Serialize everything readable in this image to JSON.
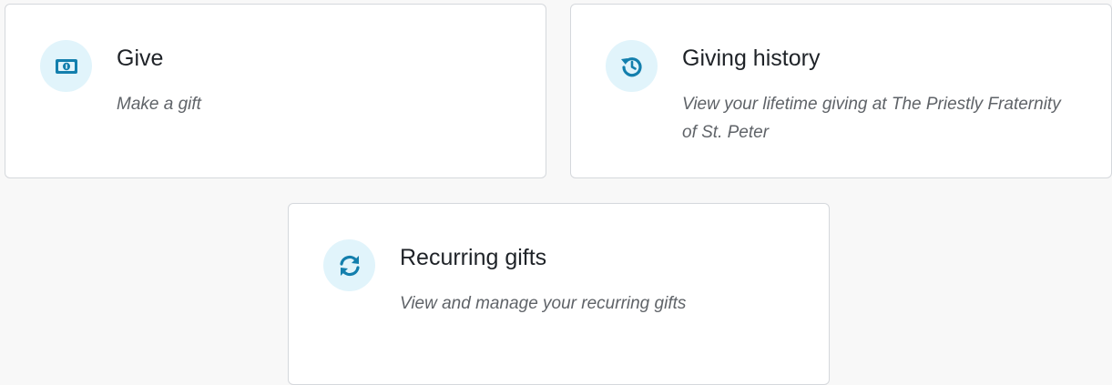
{
  "cards": {
    "give": {
      "title": "Give",
      "description": "Make a gift",
      "icon": "money-bill-icon"
    },
    "history": {
      "title": "Giving history",
      "description": "View your lifetime giving at The Priestly Fraternity of St. Peter",
      "icon": "history-icon"
    },
    "recurring": {
      "title": "Recurring gifts",
      "description": "View and manage your recurring gifts",
      "icon": "sync-icon"
    }
  },
  "colors": {
    "icon_color": "#137fad",
    "icon_background": "#e1f4fb",
    "card_border": "#d5d8dc",
    "page_background": "#f8f8f8"
  }
}
